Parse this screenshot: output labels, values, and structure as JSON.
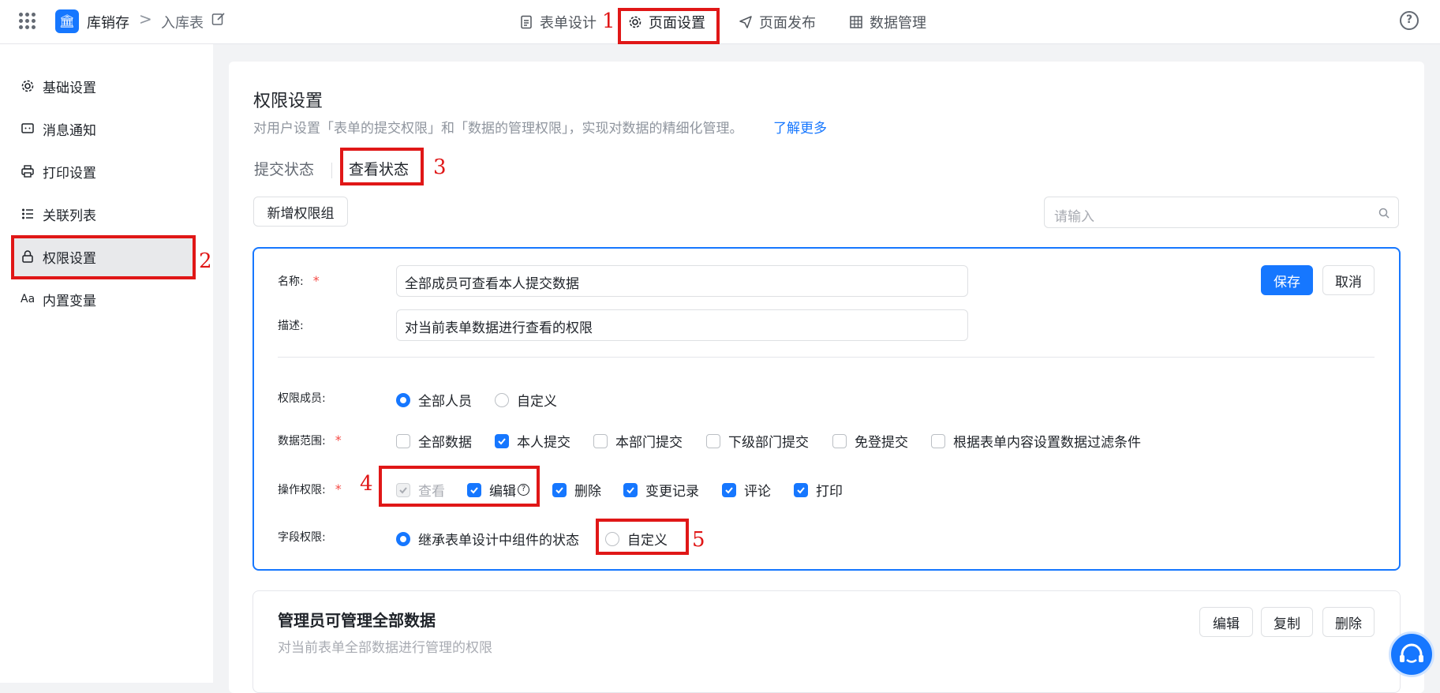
{
  "topbar": {
    "app_name": "库销存",
    "crumb_sep": ">",
    "crumb_page": "入库表",
    "logo_glyph": "🏛",
    "tabs": [
      {
        "label": "表单设计"
      },
      {
        "label": "页面设置"
      },
      {
        "label": "页面发布"
      },
      {
        "label": "数据管理"
      }
    ],
    "active_tab": "页面设置",
    "help_glyph": "?"
  },
  "sidebar": {
    "items": [
      {
        "label": "基础设置",
        "icon": "gear-icon"
      },
      {
        "label": "消息通知",
        "icon": "message-icon"
      },
      {
        "label": "打印设置",
        "icon": "printer-icon"
      },
      {
        "label": "关联列表",
        "icon": "list-icon"
      },
      {
        "label": "权限设置",
        "icon": "lock-icon"
      },
      {
        "label": "内置变量",
        "icon": "font-icon",
        "glyph": "Aa"
      }
    ],
    "active_item": "权限设置"
  },
  "main": {
    "title": "权限设置",
    "description": "对用户设置「表单的提交权限」和「数据的管理权限」，实现对数据的精细化管理。",
    "learn_more": "了解更多",
    "subtabs": [
      "提交状态",
      "查看状态"
    ],
    "active_subtab": "查看状态",
    "add_group_label": "新增权限组",
    "search_placeholder": "请输入"
  },
  "editing_group": {
    "name_label": "名称:",
    "name_value": "全部成员可查看本人提交数据",
    "desc_label": "描述:",
    "desc_value": "对当前表单数据进行查看的权限",
    "save_label": "保存",
    "cancel_label": "取消",
    "required_mark": "*",
    "members_label": "权限成员:",
    "members_options": [
      {
        "label": "全部人员",
        "checked": true
      },
      {
        "label": "自定义",
        "checked": false
      }
    ],
    "scope_label": "数据范围:",
    "scope_options": [
      {
        "label": "全部数据",
        "checked": false
      },
      {
        "label": "本人提交",
        "checked": true
      },
      {
        "label": "本部门提交",
        "checked": false
      },
      {
        "label": "下级部门提交",
        "checked": false
      },
      {
        "label": "免登提交",
        "checked": false
      },
      {
        "label": "根据表单内容设置数据过滤条件",
        "checked": false
      }
    ],
    "ops_label": "操作权限:",
    "ops_options": [
      {
        "label": "查看",
        "checked": true,
        "disabled": true
      },
      {
        "label": "编辑",
        "checked": true,
        "help": "?"
      },
      {
        "label": "删除",
        "checked": true
      },
      {
        "label": "变更记录",
        "checked": true
      },
      {
        "label": "评论",
        "checked": true
      },
      {
        "label": "打印",
        "checked": true
      }
    ],
    "field_label": "字段权限:",
    "field_options": [
      {
        "label": "继承表单设计中组件的状态",
        "checked": true
      },
      {
        "label": "自定义",
        "checked": false
      }
    ]
  },
  "group2": {
    "title": "管理员可管理全部数据",
    "description": "对当前表单全部数据进行管理的权限",
    "buttons": [
      "编辑",
      "复制",
      "删除"
    ]
  },
  "annotations": {
    "color": "#e01717",
    "numbers": [
      "1",
      "2",
      "3",
      "4",
      "5"
    ]
  },
  "colors": {
    "accent": "#1677ff",
    "annotation_red": "#e01717",
    "required": "#f54a45"
  }
}
